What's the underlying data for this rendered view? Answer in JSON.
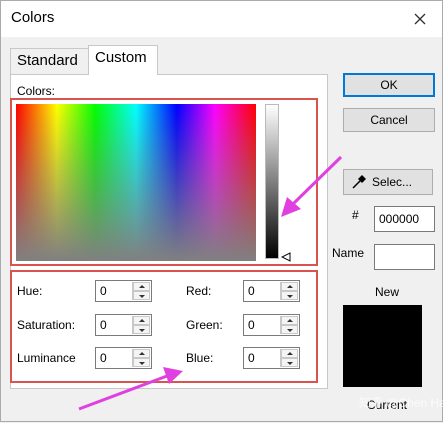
{
  "window": {
    "title": "Colors",
    "close_icon": "close-icon"
  },
  "tabs": [
    {
      "label": "Standard",
      "selected": false
    },
    {
      "label": "Custom",
      "selected": true
    }
  ],
  "custom": {
    "colors_label": "Colors:",
    "fields": {
      "hue": {
        "label": "Hue:",
        "value": "0"
      },
      "saturation": {
        "label": "Saturation:",
        "value": "0"
      },
      "luminance": {
        "label": "Luminance",
        "value": "0"
      },
      "red": {
        "label": "Red:",
        "value": "0"
      },
      "green": {
        "label": "Green:",
        "value": "0"
      },
      "blue": {
        "label": "Blue:",
        "value": "0"
      }
    }
  },
  "buttons": {
    "ok": "OK",
    "cancel": "Cancel",
    "select": "Selec..."
  },
  "hex": {
    "label": "#",
    "value": "000000"
  },
  "name": {
    "label": "Name",
    "value": ""
  },
  "preview": {
    "new_label": "New",
    "current_label": "Current",
    "color": "#000000"
  },
  "annotations": {
    "highlight_color": "#d9534f",
    "arrow_color": "#e040e0"
  },
  "watermark": "知乎 @Chen Hang"
}
